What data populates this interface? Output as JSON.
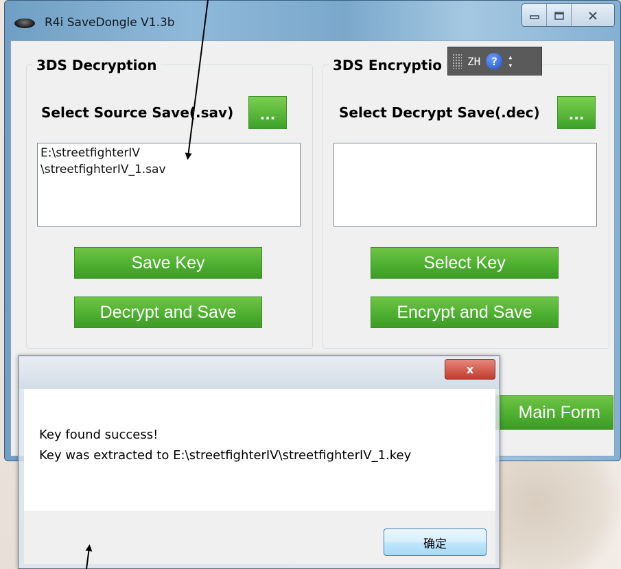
{
  "window": {
    "title": "R4i SaveDongle V1.3b",
    "buttons": [
      "minimize",
      "maximize",
      "close"
    ]
  },
  "decryption": {
    "group_title": "3DS Decryption",
    "select_label": "Select Source Save(.sav)",
    "browse_label": "...",
    "path_line1": "E:\\streetfighterIV",
    "path_line2": "\\streetfighterIV_1.sav",
    "key_button": "Save Key",
    "action_button": "Decrypt and Save"
  },
  "encryption": {
    "group_title": "3DS Encryptio",
    "select_label": "Select Decrypt Save(.dec)",
    "browse_label": "...",
    "path_value": "",
    "key_button": "Select Key",
    "action_button": "Encrypt and Save"
  },
  "main_form_button": "Main Form",
  "ime": {
    "lang": "ZH",
    "help": "?"
  },
  "dialog": {
    "close_label": "x",
    "message_line1": "Key found success!",
    "message_line2": "Key was extracted to E:\\streetfighterIV\\streetfighterIV_1.key",
    "ok_label": "确定"
  }
}
